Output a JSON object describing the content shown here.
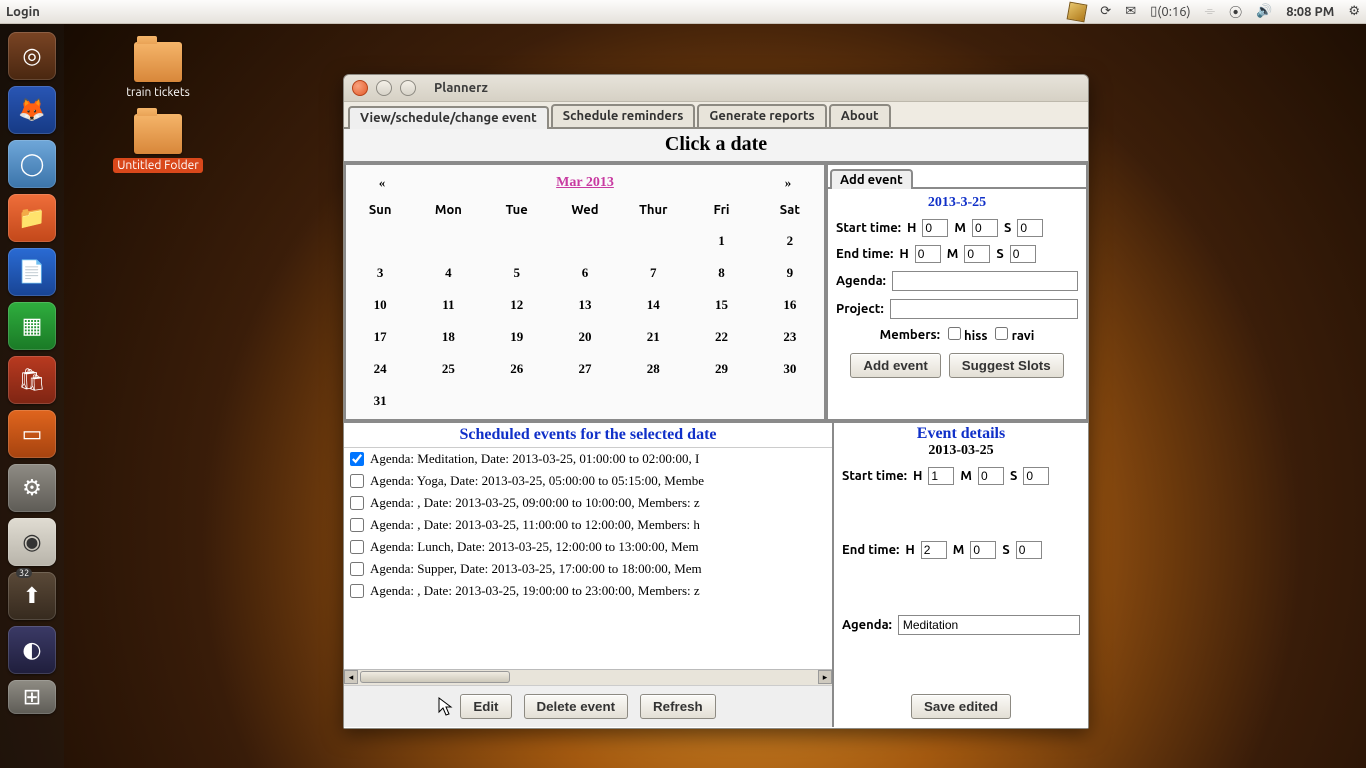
{
  "panel": {
    "left_label": "Login",
    "battery": "(0:16)",
    "clock": "8:08 PM"
  },
  "desktop": {
    "icon1": "train tickets",
    "icon2": "Untitled Folder"
  },
  "window": {
    "title": "Plannerz",
    "tabs": [
      "View/schedule/change event",
      "Schedule reminders",
      "Generate reports",
      "About"
    ],
    "click_date": "Click a date",
    "calendar": {
      "prev": "«",
      "next": "»",
      "month": "Mar 2013",
      "dow": [
        "Sun",
        "Mon",
        "Tue",
        "Wed",
        "Thur",
        "Fri",
        "Sat"
      ],
      "weeks": [
        [
          "",
          "",
          "",
          "",
          "",
          "1",
          "2"
        ],
        [
          "3",
          "4",
          "5",
          "6",
          "7",
          "8",
          "9"
        ],
        [
          "10",
          "11",
          "12",
          "13",
          "14",
          "15",
          "16"
        ],
        [
          "17",
          "18",
          "19",
          "20",
          "21",
          "22",
          "23"
        ],
        [
          "24",
          "25",
          "26",
          "27",
          "28",
          "29",
          "30"
        ],
        [
          "31",
          "",
          "",
          "",
          "",
          "",
          ""
        ]
      ]
    },
    "add_event": {
      "tab": "Add event",
      "date": "2013-3-25",
      "start_label": "Start time:",
      "end_label": "End time:",
      "agenda_label": "Agenda:",
      "project_label": "Project:",
      "members_label": "Members:",
      "member1": "hiss",
      "member2": "ravi",
      "btn_add": "Add event",
      "btn_suggest": "Suggest Slots",
      "start": {
        "h": "0",
        "m": "0",
        "s": "0"
      },
      "end": {
        "h": "0",
        "m": "0",
        "s": "0"
      },
      "H": "H",
      "M": "M",
      "S": "S"
    },
    "events": {
      "title": "Scheduled events for the selected date",
      "rows": [
        "Agenda: Meditation, Date: 2013-03-25, 01:00:00 to 02:00:00, I",
        "Agenda: Yoga, Date: 2013-03-25, 05:00:00 to 05:15:00, Membe",
        "Agenda: , Date: 2013-03-25, 09:00:00 to 10:00:00, Members: z",
        "Agenda: , Date: 2013-03-25, 11:00:00 to 12:00:00, Members: h",
        "Agenda: Lunch, Date: 2013-03-25, 12:00:00 to 13:00:00, Mem",
        "Agenda: Supper, Date: 2013-03-25, 17:00:00 to 18:00:00, Mem",
        "Agenda: , Date: 2013-03-25, 19:00:00 to 23:00:00, Members: z"
      ],
      "btn_edit": "Edit",
      "btn_delete": "Delete event",
      "btn_refresh": "Refresh"
    },
    "details": {
      "title": "Event details",
      "date": "2013-03-25",
      "start_label": "Start time:",
      "end_label": "End time:",
      "agenda_label": "Agenda:",
      "start": {
        "h": "1",
        "m": "0",
        "s": "0"
      },
      "end": {
        "h": "2",
        "m": "0",
        "s": "0"
      },
      "agenda_value": "Meditation",
      "btn_save": "Save edited",
      "H": "H",
      "M": "M",
      "S": "S"
    }
  }
}
